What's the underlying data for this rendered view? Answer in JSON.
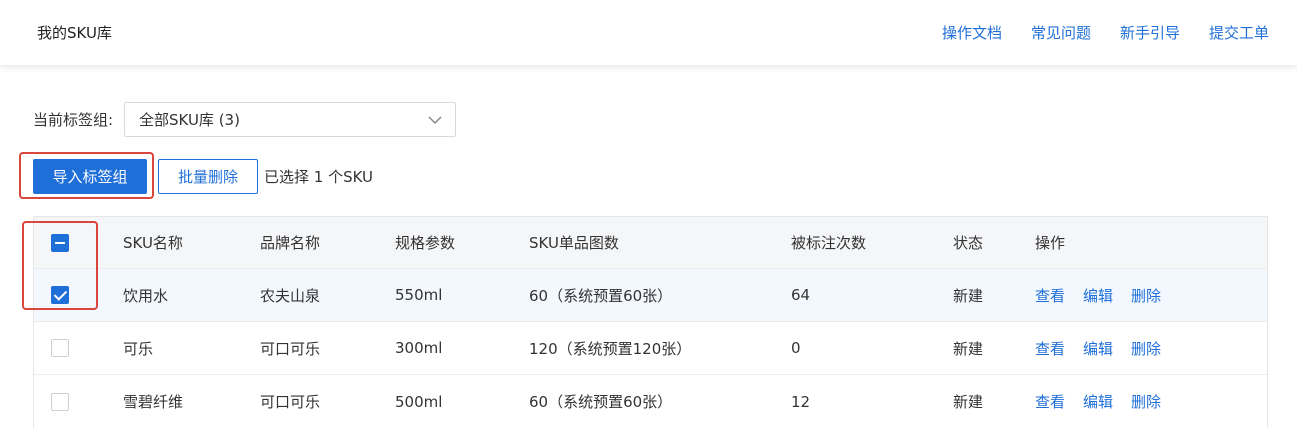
{
  "header": {
    "title": "我的SKU库",
    "links": [
      "操作文档",
      "常见问题",
      "新手引导",
      "提交工单"
    ]
  },
  "filter": {
    "label": "当前标签组:",
    "selected": "全部SKU库 (3)"
  },
  "toolbar": {
    "import_label": "导入标签组",
    "batch_delete_label": "批量删除",
    "selected_info": "已选择 1 个SKU"
  },
  "table": {
    "columns": [
      "SKU名称",
      "品牌名称",
      "规格参数",
      "SKU单品图数",
      "被标注次数",
      "状态",
      "操作"
    ],
    "rows": [
      {
        "name": "饮用水",
        "brand": "农夫山泉",
        "spec": "550ml",
        "images": "60（系统预置60张）",
        "count": "64",
        "status": "新建",
        "checked": true
      },
      {
        "name": "可乐",
        "brand": "可口可乐",
        "spec": "300ml",
        "images": "120（系统预置120张）",
        "count": "0",
        "status": "新建",
        "checked": false
      },
      {
        "name": "雪碧纤维",
        "brand": "可口可乐",
        "spec": "500ml",
        "images": "60（系统预置60张）",
        "count": "12",
        "status": "新建",
        "checked": false
      }
    ],
    "actions": {
      "view": "查看",
      "edit": "编辑",
      "delete": "删除"
    }
  },
  "colors": {
    "accent": "#1f6fd8",
    "highlight": "#d9463b",
    "selected_row": "#f3f8ff"
  }
}
